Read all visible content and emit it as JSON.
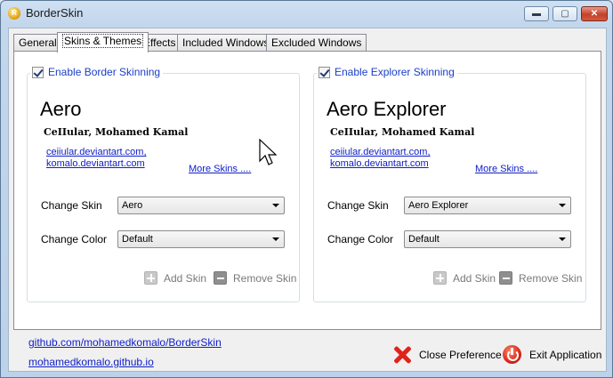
{
  "window": {
    "title": "BorderSkin",
    "icon": "app-icon"
  },
  "tabs": [
    {
      "label": "General",
      "active": false
    },
    {
      "label": "Skins & Themes",
      "active": true
    },
    {
      "label": "Effects",
      "active": false
    },
    {
      "label": "Included Windows",
      "active": false
    },
    {
      "label": "Excluded Windows",
      "active": false
    }
  ],
  "border_group": {
    "title": "Enable Border Skinning",
    "checked": true,
    "skin_name": "Aero",
    "author": "CeIIular, Mohamed Kamal",
    "link1": "ceiiular.deviantart.com,",
    "link2": "komalo.deviantart.com",
    "more": "More Skins ....",
    "change_skin_label": "Change Skin",
    "change_skin_value": "Aero",
    "change_color_label": "Change Color",
    "change_color_value": "Default",
    "add_skin": "Add Skin",
    "remove_skin": "Remove Skin"
  },
  "explorer_group": {
    "title": "Enable Explorer Skinning",
    "checked": true,
    "skin_name": "Aero Explorer",
    "author": "CeIIular, Mohamed Kamal",
    "link1": "ceiiular.deviantart.com,",
    "link2": "komalo.deviantart.com",
    "more": "More Skins ....",
    "change_skin_label": "Change Skin",
    "change_skin_value": "Aero Explorer",
    "change_color_label": "Change Color",
    "change_color_value": "Default",
    "add_skin": "Add Skin",
    "remove_skin": "Remove Skin"
  },
  "footer": {
    "link1": "github.com/mohamedkomalo/BorderSkin",
    "link2": "mohamedkomalo.github.io",
    "close_pref": "Close Preference",
    "exit_app": "Exit Application"
  },
  "colors": {
    "link": "#1020c8",
    "group_title": "#1a3fc8",
    "close_icon": "#e0231b"
  }
}
